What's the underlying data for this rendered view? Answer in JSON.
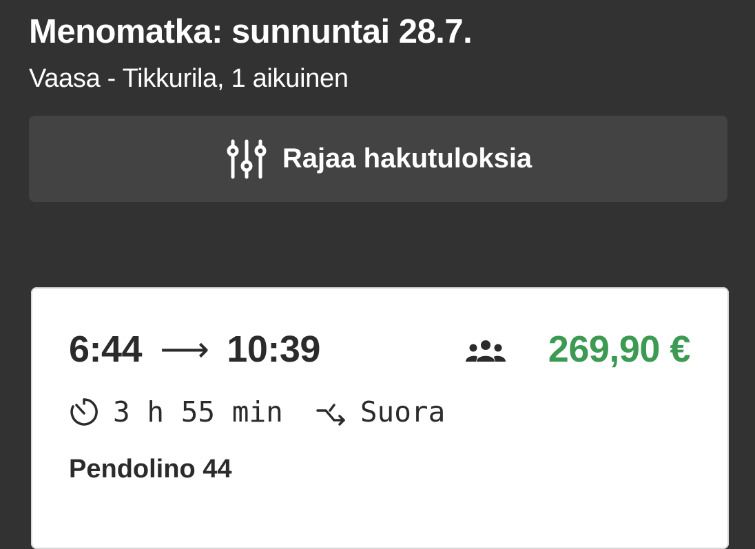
{
  "header": {
    "title": "Menomatka: sunnuntai 28.7.",
    "subtitle": "Vaasa - Tikkurila, 1 aikuinen"
  },
  "filter": {
    "label": "Rajaa hakutuloksia",
    "icon": "sliders-icon"
  },
  "results": [
    {
      "departure": "6:44",
      "arrow": "⟶",
      "arrival": "10:39",
      "capacity_icon": "group-icon",
      "price": "269,90 €",
      "duration": "3 h 55 min",
      "duration_icon": "timer-icon",
      "connection": "Suora",
      "connection_icon": "direct-route-icon",
      "train": "Pendolino 44"
    }
  ],
  "colors": {
    "background": "#323232",
    "button": "#434343",
    "card": "#ffffff",
    "price": "#3d9a52",
    "text_dark": "#2b2b2b"
  }
}
